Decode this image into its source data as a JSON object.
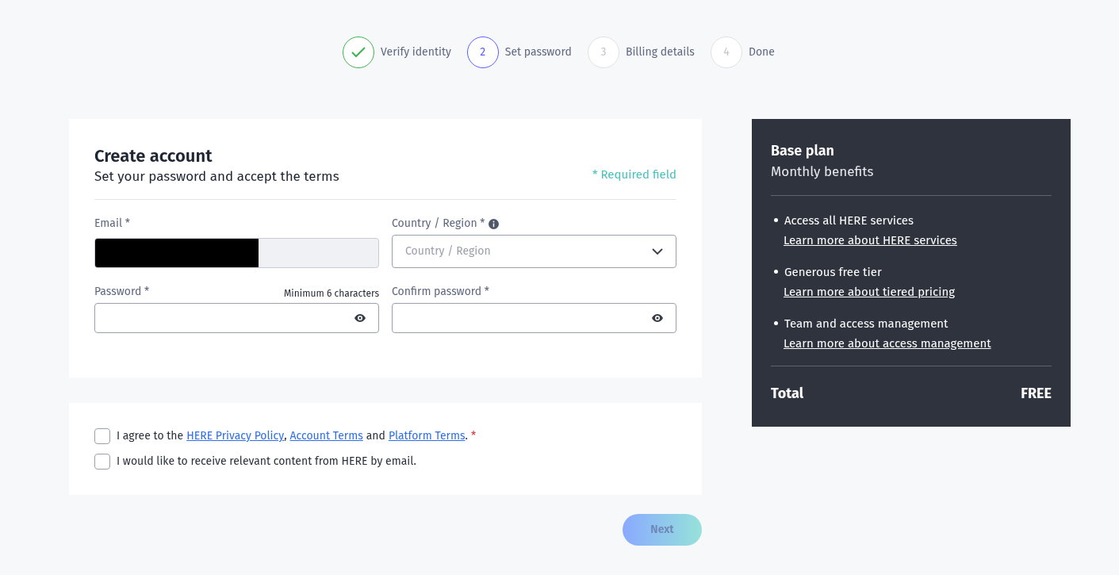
{
  "steps": [
    {
      "label": "Verify identity",
      "completed": true,
      "selected": false
    },
    {
      "number": "2",
      "label": "Set password",
      "completed": false,
      "selected": true
    },
    {
      "number": "3",
      "label": "Billing details",
      "completed": false,
      "selected": false
    },
    {
      "number": "4",
      "label": "Done",
      "completed": false,
      "selected": false
    }
  ],
  "form": {
    "title": "Create account",
    "subtitle": "Set your password and accept the terms",
    "required_note": "* Required field",
    "email": {
      "label": "Email *",
      "disabled": true,
      "redacted": true
    },
    "country": {
      "label": "Country / Region *",
      "placeholder": "Country / Region"
    },
    "password": {
      "label": "Password *",
      "hint": "Minimum 6 characters"
    },
    "confirm_password": {
      "label": "Confirm password *"
    }
  },
  "consents": [
    {
      "checked": false,
      "parts": [
        {
          "kind": "text",
          "text": "I agree to the"
        },
        {
          "kind": "link",
          "text": "HERE Privacy Policy"
        },
        {
          "kind": "text",
          "text": ","
        },
        {
          "kind": "link",
          "text": "Account Terms"
        },
        {
          "kind": "text",
          "text": "and"
        },
        {
          "kind": "link",
          "text": "Platform Terms"
        },
        {
          "kind": "text",
          "text": "."
        },
        {
          "kind": "required",
          "text": "*"
        }
      ]
    },
    {
      "checked": false,
      "parts": [
        {
          "kind": "text",
          "text": "I would like to receive relevant content from HERE by email."
        }
      ]
    }
  ],
  "next_button": {
    "label": "Next",
    "disabled": true
  },
  "plan": {
    "title": "Base plan",
    "subtitle": "Monthly benefits",
    "benefits": [
      {
        "text": "Access all HERE services",
        "link": "Learn more about HERE services"
      },
      {
        "text": "Generous free tier",
        "link": "Learn more about tiered pricing"
      },
      {
        "text": "Team and access management",
        "link": "Learn more about access management"
      }
    ],
    "total_label": "Total",
    "total_value": "FREE"
  }
}
